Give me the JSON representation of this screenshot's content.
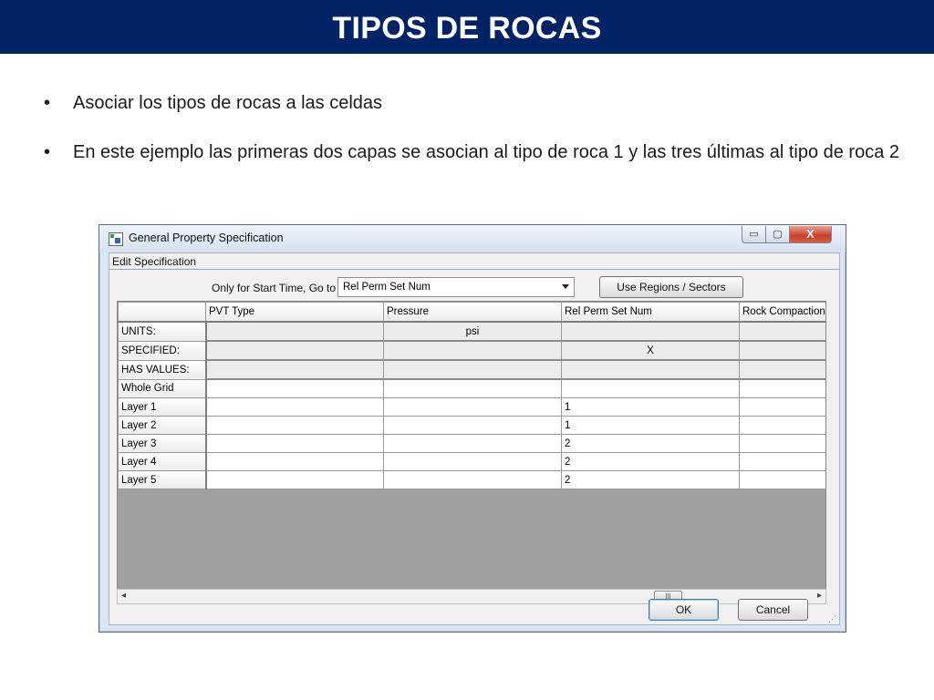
{
  "slide": {
    "title": "TIPOS DE ROCAS",
    "bullets": [
      "Asociar los tipos de rocas a las celdas",
      "En este ejemplo las primeras dos capas se asocian al tipo de roca 1 y las tres últimas al tipo de roca 2"
    ],
    "bullet_glyph": "•"
  },
  "window": {
    "title": "General Property Specification",
    "minimize_glyph": "▭",
    "maximize_glyph": "▢",
    "close_glyph": "X",
    "group_label": "Edit Specification",
    "goto_label": "Only for Start Time, Go to",
    "goto_select_value": "Rel Perm Set Num",
    "regions_button": "Use Regions / Sectors",
    "ok_button": "OK",
    "cancel_button": "Cancel"
  },
  "grid": {
    "columns": [
      "PVT Type",
      "Pressure",
      "Rel Perm Set Num",
      "Rock Compaction"
    ],
    "rows": [
      {
        "label": "UNITS:",
        "cells": [
          "",
          "psi",
          "",
          ""
        ]
      },
      {
        "label": "SPECIFIED:",
        "cells": [
          "",
          "",
          "X",
          ""
        ]
      },
      {
        "label": "HAS VALUES:",
        "cells": [
          "",
          "",
          "",
          ""
        ]
      },
      {
        "label": "Whole Grid",
        "cells": [
          "",
          "",
          "",
          ""
        ]
      },
      {
        "label": "Layer 1",
        "cells": [
          "",
          "",
          "1",
          ""
        ]
      },
      {
        "label": "Layer 2",
        "cells": [
          "",
          "",
          "1",
          ""
        ]
      },
      {
        "label": "Layer 3",
        "cells": [
          "",
          "",
          "2",
          ""
        ]
      },
      {
        "label": "Layer 4",
        "cells": [
          "",
          "",
          "2",
          ""
        ]
      },
      {
        "label": "Layer 5",
        "cells": [
          "",
          "",
          "2",
          ""
        ]
      }
    ]
  },
  "scrollbar": {
    "left_glyph": "◂",
    "right_glyph": "▸",
    "thumb_glyph": "|||"
  },
  "colors": {
    "title_bar": "#002366",
    "grid_empty_area": "#a0a0a0"
  }
}
